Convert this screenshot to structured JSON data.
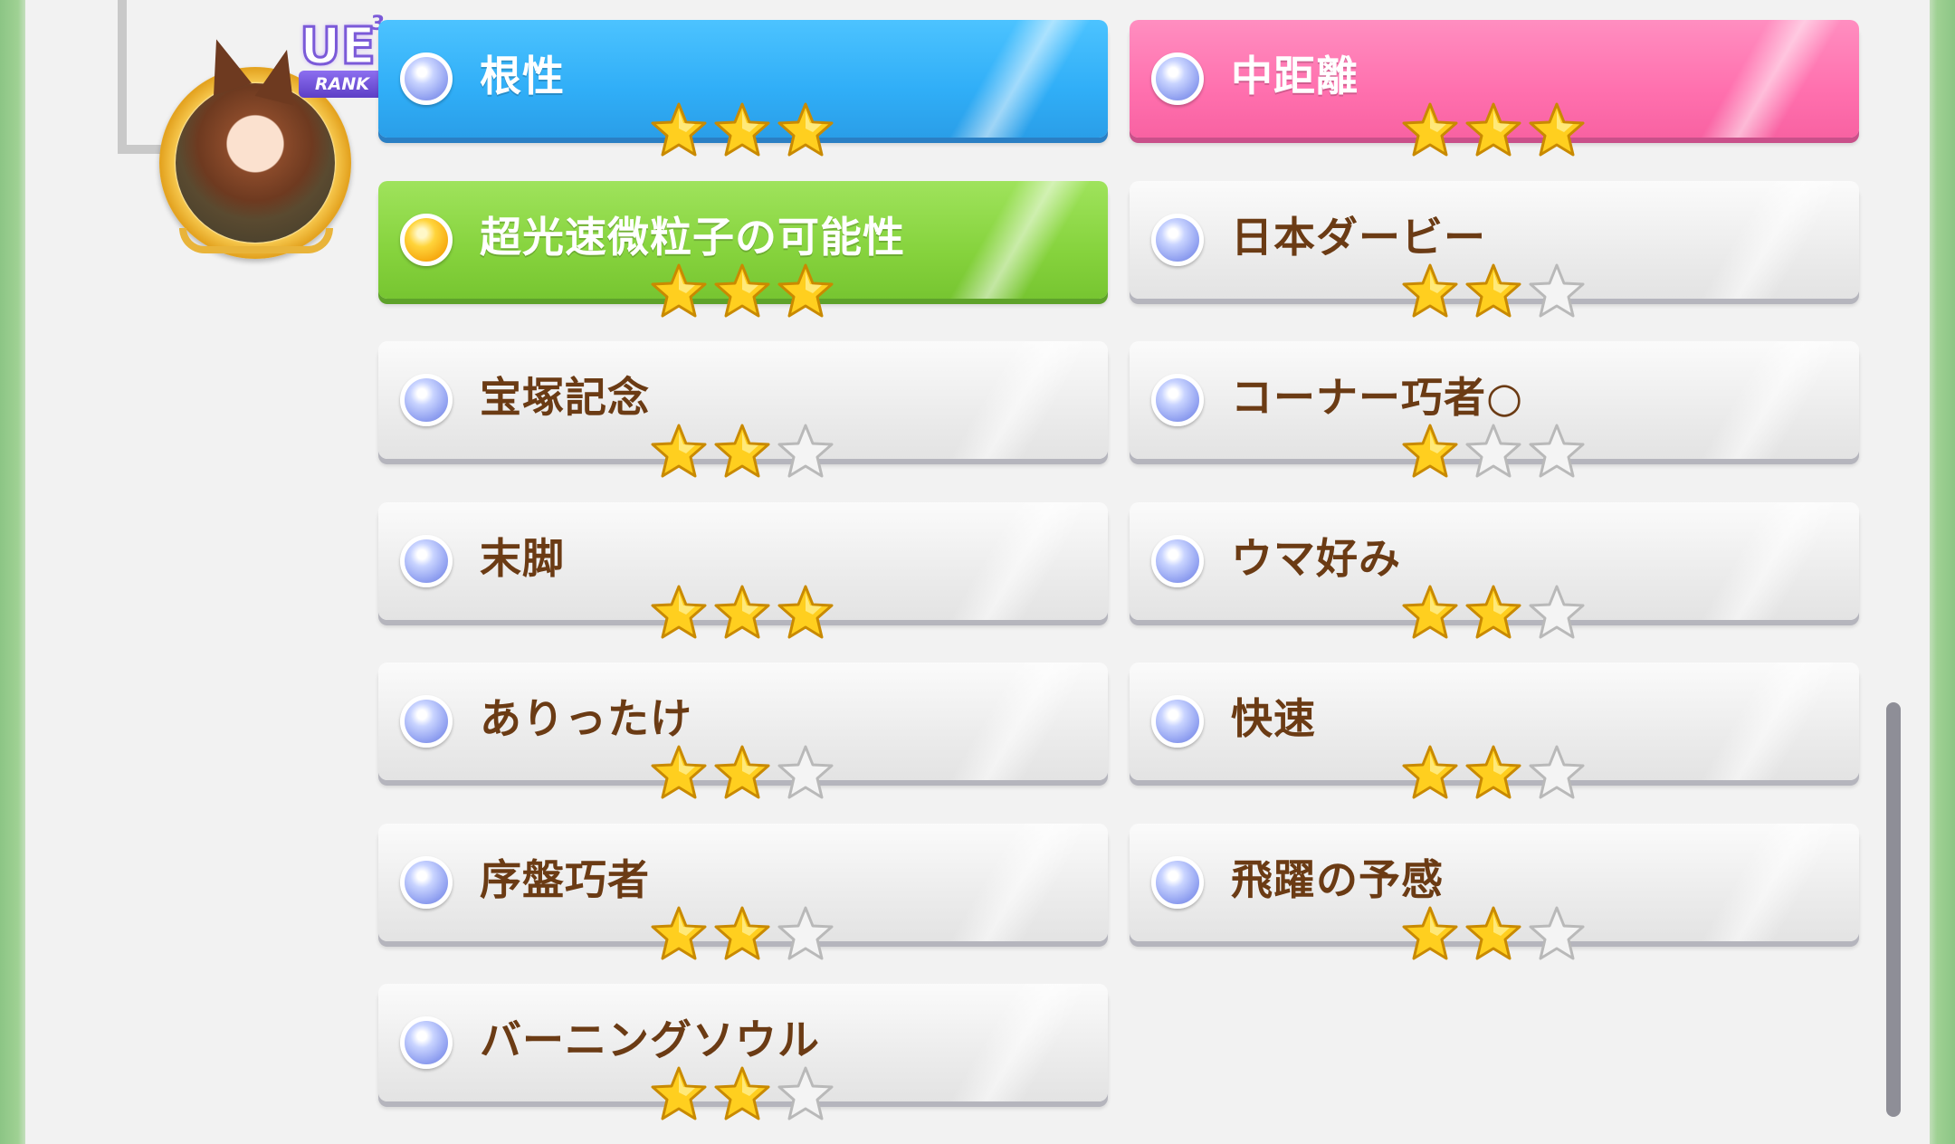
{
  "rank_badge": {
    "label": "UE",
    "superscript": "3",
    "tag": "RANK"
  },
  "skills": [
    {
      "label": "根性",
      "style": "blue",
      "lamp": "blue",
      "stars": 3
    },
    {
      "label": "中距離",
      "style": "pink",
      "lamp": "blue",
      "stars": 3
    },
    {
      "label": "超光速微粒子の可能性",
      "style": "green",
      "lamp": "gold",
      "stars": 3
    },
    {
      "label": "日本ダービー",
      "style": "gray",
      "lamp": "blue",
      "stars": 2
    },
    {
      "label": "宝塚記念",
      "style": "gray",
      "lamp": "blue",
      "stars": 2
    },
    {
      "label": "コーナー巧者○",
      "style": "gray",
      "lamp": "blue",
      "stars": 1
    },
    {
      "label": "末脚",
      "style": "gray",
      "lamp": "blue",
      "stars": 3
    },
    {
      "label": "ウマ好み",
      "style": "gray",
      "lamp": "blue",
      "stars": 2
    },
    {
      "label": "ありったけ",
      "style": "gray",
      "lamp": "blue",
      "stars": 2
    },
    {
      "label": "快速",
      "style": "gray",
      "lamp": "blue",
      "stars": 2
    },
    {
      "label": "序盤巧者",
      "style": "gray",
      "lamp": "blue",
      "stars": 2
    },
    {
      "label": "飛躍の予感",
      "style": "gray",
      "lamp": "blue",
      "stars": 2
    },
    {
      "label": "バーニングソウル",
      "style": "gray",
      "lamp": "blue",
      "stars": 2
    }
  ],
  "colors": {
    "label_text": "#6b3b14",
    "star_filled": "#ffcf1f",
    "star_empty": "#f4f4f4",
    "accent_blue": "#30aef7",
    "accent_pink": "#ff70ae",
    "accent_green": "#86d33d"
  }
}
